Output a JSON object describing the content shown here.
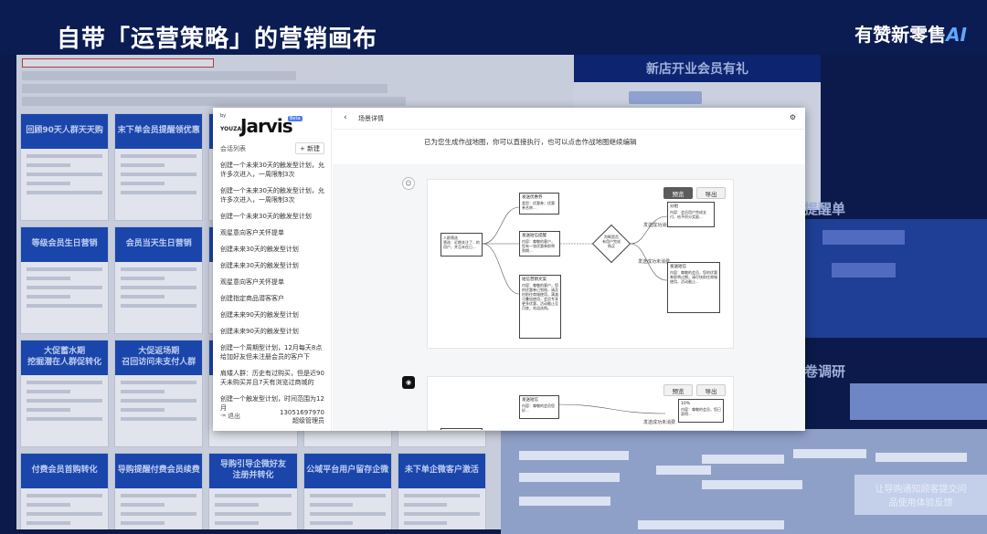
{
  "slide": {
    "title": "自带「运营策略」的营销画布",
    "brand_text": "有赞新零售",
    "brand_ai": "AI"
  },
  "background": {
    "left_cards": [
      "回顾90天人群天天购",
      "末下单会员提醒领优惠",
      "",
      "",
      "",
      "等级会员生日营销",
      "会员当天生日营销",
      "",
      "",
      "",
      "大促蓄水期\n挖掘潜在人群促转化",
      "大促返场期\n召回访问未支付人群",
      "",
      "",
      "",
      "付费会员首购转化",
      "导购提醒付费会员续费",
      "导购引导企微好友\n注册并转化",
      "公域平台用户留存企微",
      "未下单企微客户激活"
    ],
    "right_top_label": "新店开业会员有礼",
    "right_mid_label": "提醒单",
    "right_survey_label": "问卷调研",
    "right_bottom_card": "让导购通知顾客提交问\n品使用体验反馈"
  },
  "sidebar": {
    "logo_by": "by",
    "logo_youzan": "YOUZAN",
    "logo_name": "Jarvis",
    "logo_badge": "Beta",
    "section_label": "会话列表",
    "new_button": "+  新建",
    "items": [
      "创建一个未来30天的触发型计划，允许多次进入，一周限制3次",
      "创建一个未来30天的触发型计划，允许多次进入，一周限制3次",
      "创建一个未来30天的触发型计划",
      "观星意向客户关怀提单",
      "创建未来30天的触发型计划",
      "创建未来30天的触发型计划",
      "观星意向客户关怀提单",
      "创建指定商品潜客客户",
      "创建未来90天的触发型计划",
      "创建未来90天的触发型计划",
      "创建一个周期型计划，12月每天8点给加好友但未注册会员的客户下发”注...",
      "肩矮人群：历史有过购买，但是近90天未购买并且7天有浏览过商城的全...",
      "创建一个触发型计划，时间范围为12月"
    ],
    "footer_label": "退出",
    "footer_phone": "13051697970",
    "footer_role": "超级管理员"
  },
  "main": {
    "topbar_title": "场景详情",
    "prompt": "已为您生成作战地图，你可以直接执行，也可以点击作战地图继续编辑",
    "card1_btn_preview": "预览",
    "card1_btn_export": "导出",
    "card2_btn_preview": "预览",
    "card2_btn_export": "导出",
    "flow": {
      "start_node": "人群筛选\n筛选：近期关注了...的用户，并且未在已...",
      "node_a_title": "发送优惠券",
      "node_a_body": "类型：优惠券；优惠券名称...",
      "node_b_title": "发送短信提醒",
      "node_b_body": "内容：尊敬的客户，您有一张优惠券即将到期...",
      "node_c_title": "短信营销文案",
      "node_c_body": "内容：尊敬的客户，您的优惠券已到账，请及时前往商城使用，满减可叠加使用，会员专享更多优惠，活动截止至月底，欢迎选购。",
      "diamond": "判断是否\n有用户完成\n购买",
      "edge_yes": "发送成功消费",
      "edge_no": "发送成功未消费",
      "node_d_title": "分组",
      "node_d_body": "内容：会员用户完成支付，给予积分奖励...",
      "node_e_title": "发送短信",
      "node_e_body": "内容：尊敬的会员，您的优惠券即将过期，请尽快前往商城使用，活动截止..."
    },
    "flow2": {
      "node_a_title": "发送短信",
      "node_a_body": "内容：尊敬的会员您好...",
      "node_b_title": "10%",
      "node_b_body": "内容：尊敬的会员，您已获得...",
      "edge_label": "发送成功未消费"
    }
  },
  "colors": {
    "slide_bg": "#0b1a4a",
    "card_banner": "#1c4ab4",
    "accent": "#4a7bf5"
  }
}
